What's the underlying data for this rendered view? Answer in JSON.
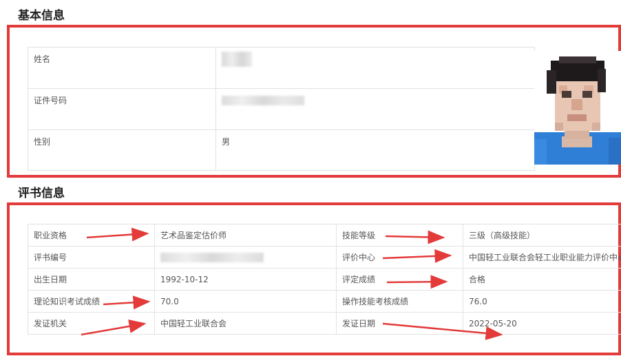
{
  "basic": {
    "title": "基本信息",
    "rows": [
      {
        "label": "姓名",
        "value": ""
      },
      {
        "label": "证件号码",
        "value": ""
      },
      {
        "label": "性别",
        "value": "男"
      }
    ]
  },
  "cert": {
    "title": "评书信息",
    "rows": [
      {
        "l1": "职业资格",
        "v1": "艺术品鉴定估价师",
        "l2": "技能等级",
        "v2": "三级（高级技能）"
      },
      {
        "l1": "评书编号",
        "v1": "",
        "l2": "评价中心",
        "v2": "中国轻工业联合会轻工业职业能力评价中心"
      },
      {
        "l1": "出生日期",
        "v1": "1992-10-12",
        "l2": "评定成绩",
        "v2": "合格"
      },
      {
        "l1": "理论知识考试成绩",
        "v1": "70.0",
        "l2": "操作技能考核成绩",
        "v2": "76.0"
      },
      {
        "l1": "发证机关",
        "v1": "中国轻工业联合会",
        "l2": "发证日期",
        "v2": "2022-05-20"
      }
    ]
  },
  "colors": {
    "highlight": "#e33a3a",
    "border": "#e2e2e2"
  },
  "icons": {
    "photo": "person-photo-pixelated",
    "annotation": "red-arrow"
  }
}
